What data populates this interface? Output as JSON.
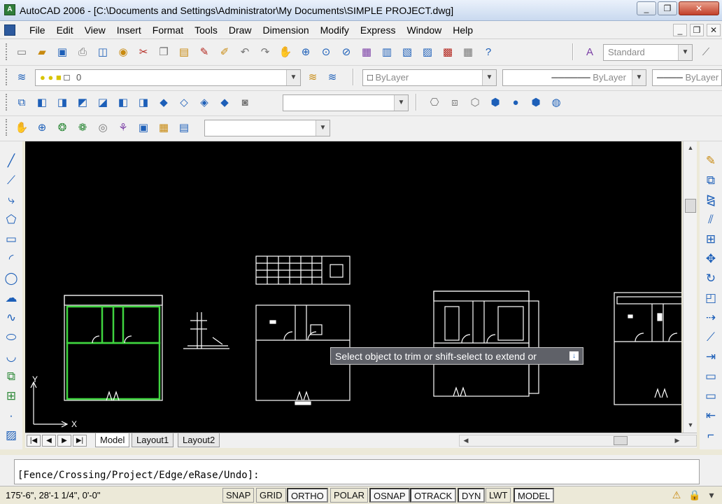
{
  "window": {
    "title": "AutoCAD 2006 - [C:\\Documents and Settings\\Administrator\\My Documents\\SIMPLE PROJECT.dwg]",
    "buttons": [
      "_",
      "❐",
      "✕"
    ]
  },
  "menubar": {
    "items": [
      "File",
      "Edit",
      "View",
      "Insert",
      "Format",
      "Tools",
      "Draw",
      "Dimension",
      "Modify",
      "Express",
      "Window",
      "Help"
    ],
    "mdi_buttons": [
      "_",
      "❐",
      "✕"
    ]
  },
  "toolbars": {
    "standard_icons": [
      "new-icon",
      "open-icon",
      "save-icon",
      "plot-icon",
      "plot-preview-icon",
      "publish-icon",
      "cut-icon",
      "copy-icon",
      "paste-icon",
      "match-properties-icon",
      "block-editor-icon",
      "undo-icon",
      "redo-icon",
      "pan-icon",
      "zoom-realtime-icon",
      "zoom-window-icon",
      "zoom-previous-icon",
      "properties-icon",
      "design-center-icon",
      "tool-palettes-icon",
      "sheet-set-icon",
      "markup-icon",
      "calculator-icon",
      "help-icon"
    ],
    "text_style": "Standard",
    "layer_current": "0",
    "color_control": "ByLayer",
    "linetype_control": "ByLayer",
    "lineweight_control": "ByLayer"
  },
  "canvas": {
    "ucs_x": "X",
    "ucs_y": "Y",
    "tooltip": "Select object to trim or shift-select to extend or"
  },
  "tabs": {
    "items": [
      "Model",
      "Layout1",
      "Layout2"
    ],
    "active": "Model"
  },
  "command_line": {
    "text": "[Fence/Crossing/Project/Edge/eRase/Undo]:"
  },
  "status_bar": {
    "coordinates": "175'-6\",    28'-1 1/4\", 0'-0\"",
    "toggles": [
      {
        "label": "SNAP",
        "on": false
      },
      {
        "label": "GRID",
        "on": false
      },
      {
        "label": "ORTHO",
        "on": true
      },
      {
        "label": "POLAR",
        "on": false
      },
      {
        "label": "OSNAP",
        "on": true
      },
      {
        "label": "OTRACK",
        "on": true
      },
      {
        "label": "DYN",
        "on": true
      },
      {
        "label": "LWT",
        "on": false
      },
      {
        "label": "MODEL",
        "on": true
      }
    ]
  }
}
